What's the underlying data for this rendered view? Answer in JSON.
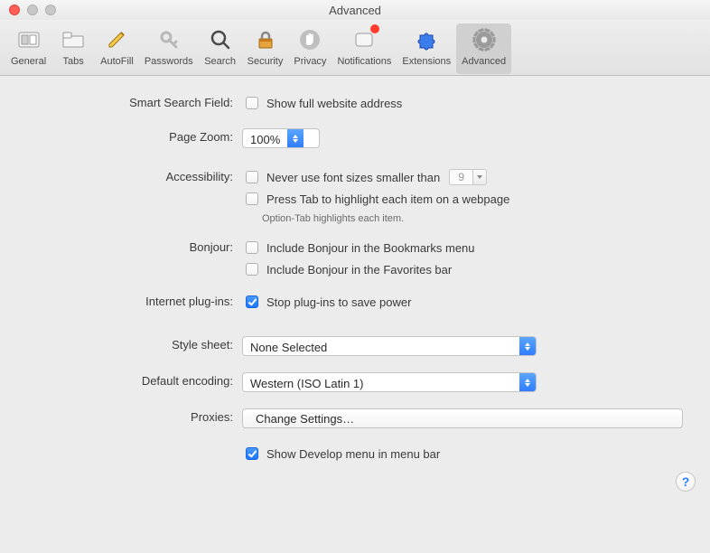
{
  "window": {
    "title": "Advanced"
  },
  "toolbar": [
    {
      "id": "general",
      "label": "General",
      "icon": "switch"
    },
    {
      "id": "tabs",
      "label": "Tabs",
      "icon": "tabs"
    },
    {
      "id": "autofill",
      "label": "AutoFill",
      "icon": "pencil"
    },
    {
      "id": "passwords",
      "label": "Passwords",
      "icon": "key"
    },
    {
      "id": "search",
      "label": "Search",
      "icon": "magnifier"
    },
    {
      "id": "security",
      "label": "Security",
      "icon": "lock"
    },
    {
      "id": "privacy",
      "label": "Privacy",
      "icon": "hand"
    },
    {
      "id": "notifications",
      "label": "Notifications",
      "icon": "badge",
      "dot": true
    },
    {
      "id": "extensions",
      "label": "Extensions",
      "icon": "puzzle"
    },
    {
      "id": "advanced",
      "label": "Advanced",
      "icon": "gear",
      "selected": true
    }
  ],
  "sections": {
    "smart_search": {
      "label": "Smart Search Field:",
      "show_full_address": {
        "label": "Show full website address",
        "checked": false
      }
    },
    "page_zoom": {
      "label": "Page Zoom:",
      "value": "100%"
    },
    "accessibility": {
      "label": "Accessibility:",
      "never_smaller": {
        "label": "Never use font sizes smaller than",
        "checked": false,
        "value": "9"
      },
      "press_tab": {
        "label": "Press Tab to highlight each item on a webpage",
        "checked": false
      },
      "hint": "Option-Tab highlights each item."
    },
    "bonjour": {
      "label": "Bonjour:",
      "bookmarks": {
        "label": "Include Bonjour in the Bookmarks menu",
        "checked": false
      },
      "favorites": {
        "label": "Include Bonjour in the Favorites bar",
        "checked": false
      }
    },
    "plugins": {
      "label": "Internet plug-ins:",
      "stop_plugins": {
        "label": "Stop plug-ins to save power",
        "checked": true
      }
    },
    "style_sheet": {
      "label": "Style sheet:",
      "value": "None Selected"
    },
    "encoding": {
      "label": "Default encoding:",
      "value": "Western (ISO Latin 1)"
    },
    "proxies": {
      "label": "Proxies:",
      "button": "Change Settings…"
    },
    "develop": {
      "label": "Show Develop menu in menu bar",
      "checked": true
    }
  },
  "help": "?"
}
